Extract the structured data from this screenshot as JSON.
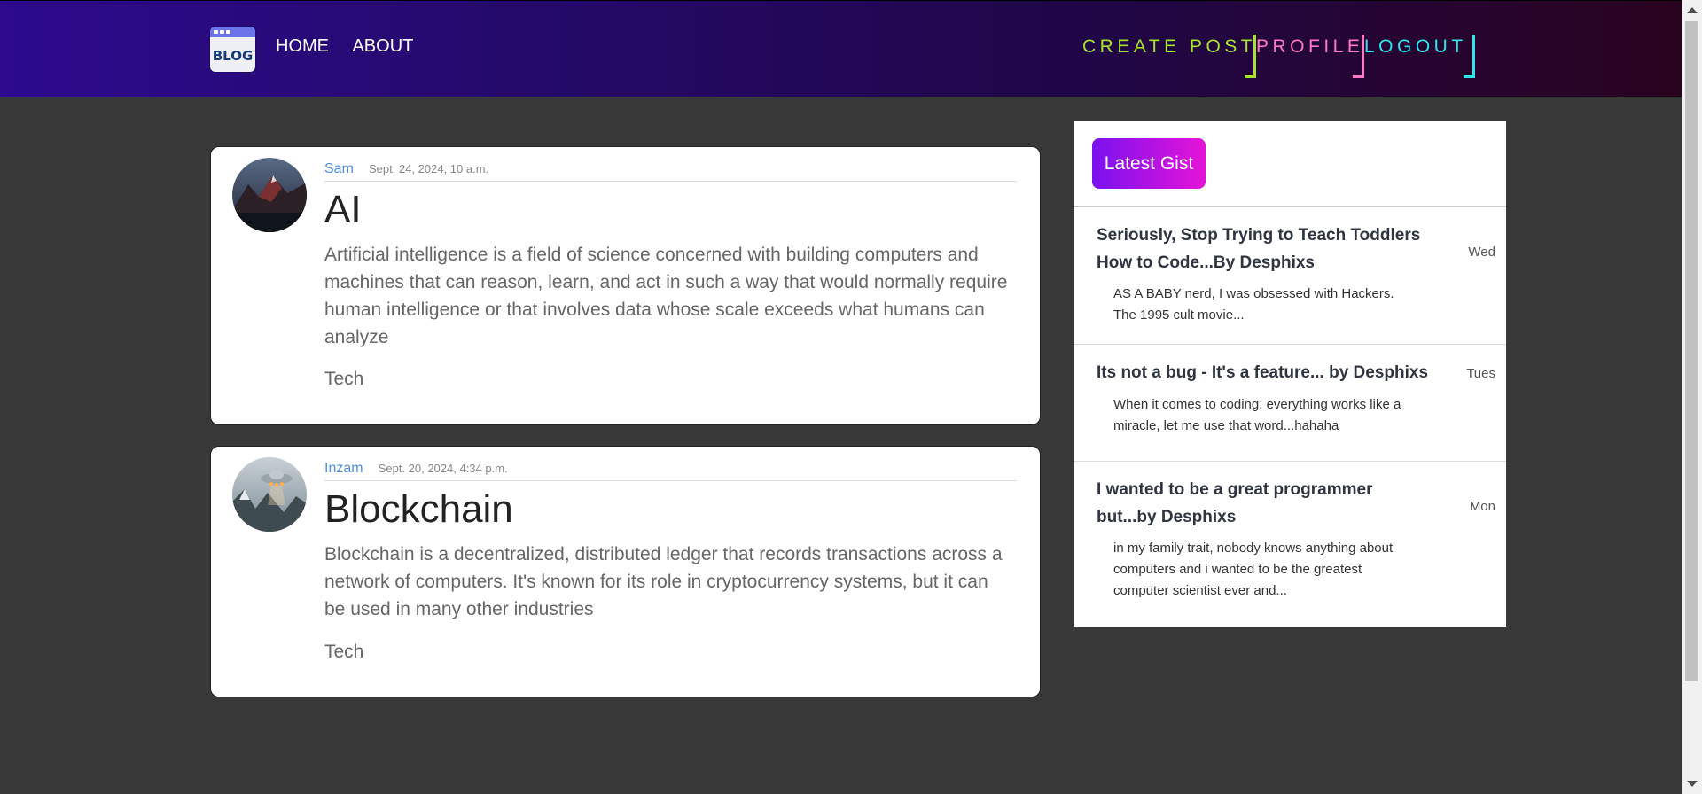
{
  "header": {
    "logo_text": "BLOG",
    "nav": [
      {
        "label": "HOME"
      },
      {
        "label": "ABOUT"
      }
    ],
    "actions": [
      {
        "label": "CREATE POST",
        "color": "#a6e22e"
      },
      {
        "label": "PROFILE",
        "color": "#ff79c6"
      },
      {
        "label": "LOGOUT",
        "color": "#2ee6e6"
      }
    ]
  },
  "posts": [
    {
      "author": "Sam",
      "date": "Sept. 24, 2024, 10 a.m.",
      "title": "AI",
      "body": "Artificial intelligence is a field of science concerned with building computers and machines that can reason, learn, and act in such a way that would normally require human intelligence or that involves data whose scale exceeds what humans can analyze",
      "tag": "Tech",
      "avatar": "mountain-photo"
    },
    {
      "author": "Inzam",
      "date": "Sept. 20, 2024, 4:34 p.m.",
      "title": "Blockchain",
      "body": "Blockchain is a decentralized, distributed ledger that records transactions across a network of computers. It's known for its role in cryptocurrency systems, but it can be used in many other industries",
      "tag": "Tech",
      "avatar": "ufo-photo"
    }
  ],
  "sidebar": {
    "button_label": "Latest Gist",
    "items": [
      {
        "title": "Seriously, Stop Trying to Teach Toddlers How to Code...By Desphixs",
        "day": "Wed",
        "excerpt": "AS A BABY nerd, I was obsessed with Hackers. The 1995 cult movie..."
      },
      {
        "title": "Its not a bug - It's a feature... by Desphixs",
        "day": "Tues",
        "excerpt": "When it comes to coding, everything works like a miracle, let me use that word...hahaha"
      },
      {
        "title": "I wanted to be a great programmer but...by Desphixs",
        "day": "Mon",
        "excerpt": "in my family trait, nobody knows anything about computers and i wanted to be the greatest computer scientist ever and..."
      }
    ]
  }
}
